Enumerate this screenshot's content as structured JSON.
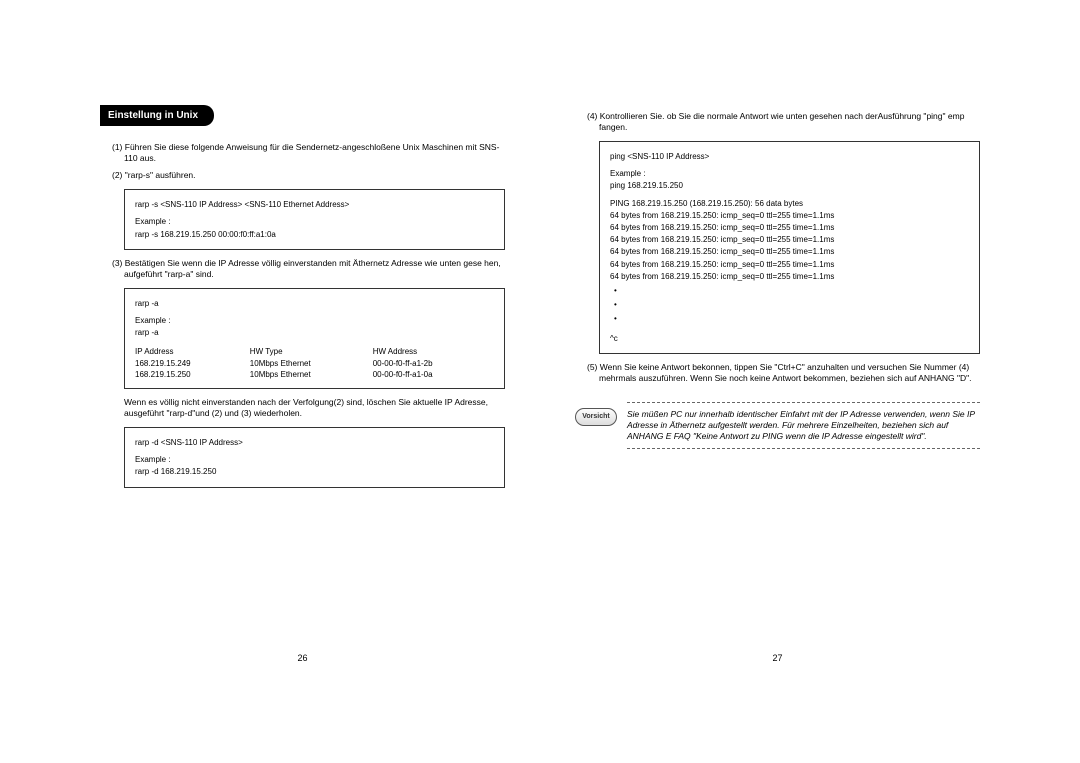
{
  "left": {
    "header": "Einstellung in Unix",
    "item1": "(1) Führen Sie diese folgende Anweisung für die Sendernetz-angeschloßene Unix Maschinen mit SNS-110 aus.",
    "item2": "(2) \"rarp-s\" ausführen.",
    "box1": {
      "cmd": "rarp -s <SNS-110 IP Address> <SNS-110 Ethernet Address>",
      "ex_label": "Example :",
      "ex": "rarp -s 168.219.15.250 00:00:f0:ff:a1:0a"
    },
    "item3": "(3) Bestätigen Sie wenn die IP Adresse völlig einverstanden mit Äthernetz Adresse wie unten gese hen, aufgeführt \"rarp-a\" sind.",
    "box2": {
      "cmd": "rarp -a",
      "ex_label": "Example :",
      "ex": "rarp -a",
      "hdr_ip": "IP Address",
      "hdr_hw": "HW Type",
      "hdr_addr": "HW Address",
      "r1_ip": "168.219.15.249",
      "r1_hw": "10Mbps Ethernet",
      "r1_addr": "00-00-f0-ff-a1-2b",
      "r2_ip": "168.219.15.250",
      "r2_hw": "10Mbps Ethernet",
      "r2_addr": "00-00-f0-ff-a1-0a"
    },
    "desc4": "Wenn es völlig nicht einverstanden nach der Verfolgung(2) sind, löschen Sie aktuelle IP Adresse, ausgeführt \"rarp-d\"und (2) und (3) wiederholen.",
    "box3": {
      "cmd": "rarp -d <SNS-110 IP Address>",
      "ex_label": "Example :",
      "ex": "rarp -d 168.219.15.250"
    },
    "page_num": "26"
  },
  "right": {
    "item4": "(4) Kontrollieren Sie. ob Sie die normale Antwort wie unten gesehen nach derAusführung \"ping\" emp fangen.",
    "box4": {
      "cmd": "ping <SNS-110 IP Address>",
      "ex_label": "Example :",
      "ex": "ping 168.219.15.250",
      "out1": "PING 168.219.15.250 (168.219.15.250): 56 data bytes",
      "out2": "64 bytes from 168.219.15.250: icmp_seq=0 ttl=255 time=1.1ms",
      "out3": "64 bytes from 168.219.15.250: icmp_seq=0 ttl=255 time=1.1ms",
      "out4": "64 bytes from 168.219.15.250: icmp_seq=0 ttl=255 time=1.1ms",
      "out5": "64 bytes from 168.219.15.250: icmp_seq=0 ttl=255 time=1.1ms",
      "out6": "64 bytes from 168.219.15.250: icmp_seq=0 ttl=255 time=1.1ms",
      "out7": "64 bytes from 168.219.15.250: icmp_seq=0 ttl=255 time=1.1ms",
      "ctrlc": "^c"
    },
    "item5": "(5) Wenn Sie keine Antwort bekonnen, tippen Sie \"Ctrl+C\" anzuhalten und versuchen Sie Nummer (4) mehrmals auszuführen. Wenn Sie noch keine Antwort bekommen, beziehen sich auf ANHANG \"D\".",
    "caution_label": "Vorsicht",
    "caution_text": "Sie müßen PC nur innerhalb identischer Einfahrt mit der IP Adresse verwenden, wenn Sie IP Adresse in Äthernetz aufgestellt werden. Für mehrere Einzelheiten, beziehen sich auf ANHANG E FAQ \"Keine Antwort zu PING wenn die IP Adresse eingestellt wird\".",
    "page_num": "27"
  }
}
